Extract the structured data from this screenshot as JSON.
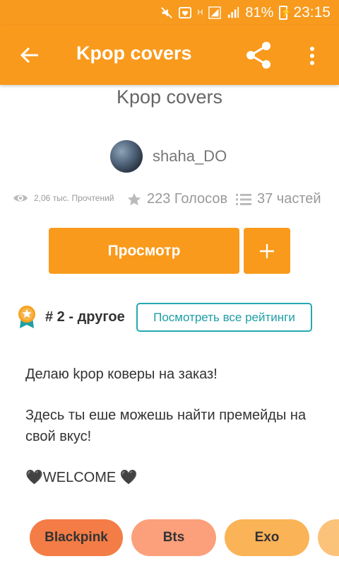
{
  "status": {
    "battery": "81%",
    "time": "23:15",
    "network_label": "H"
  },
  "appbar": {
    "title": "Kpop covers"
  },
  "story": {
    "title": "Kpop covers",
    "author": "shaha_DO",
    "views": "2,06 тыс. Прочтений",
    "votes": "223 Голосов",
    "parts": "37 частей"
  },
  "actions": {
    "read_label": "Просмотр",
    "add_label": "+"
  },
  "ranking": {
    "text": "# 2 - другое",
    "button_label": "Посмотреть все рейтинги"
  },
  "description": {
    "line1": "Делаю kpop коверы на заказ!",
    "line2": "Здесь ты еше можешь найти премейды на свой вкус!",
    "line3": "🖤WELCOME 🖤"
  },
  "tags": [
    "Blackpink",
    "Bts",
    "Exo"
  ],
  "colors": {
    "accent": "#f99a1c",
    "teal": "#26a9b0",
    "tag1": "#f47c46",
    "tag2": "#fca07b",
    "tag3": "#fbb357"
  }
}
